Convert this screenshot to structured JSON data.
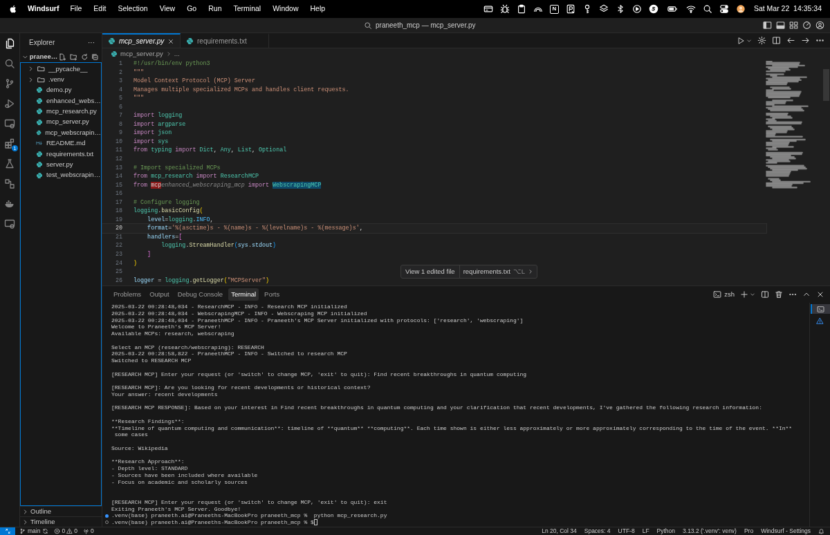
{
  "menu_bar": {
    "app": "Windsurf",
    "menus": [
      "File",
      "Edit",
      "Selection",
      "View",
      "Go",
      "Run",
      "Terminal",
      "Window",
      "Help"
    ],
    "status_icons": [
      {
        "kind": "card"
      },
      {
        "kind": "bug"
      },
      {
        "kind": "clipboard"
      },
      {
        "kind": "gauge"
      },
      {
        "kind": "letter",
        "label": "N"
      },
      {
        "kind": "document"
      },
      {
        "kind": "key"
      },
      {
        "kind": "layers"
      },
      {
        "kind": "bluetooth"
      },
      {
        "kind": "play"
      },
      {
        "kind": "disc"
      },
      {
        "kind": "battery"
      },
      {
        "kind": "wifi"
      },
      {
        "kind": "search"
      },
      {
        "kind": "toggles"
      },
      {
        "kind": "avatar"
      }
    ],
    "clock": "Sat Mar 22  14:35:34"
  },
  "title_bar": {
    "search": "praneeth_mcp — mcp_server.py"
  },
  "activity_bar": [
    {
      "kind": "files",
      "selected": true
    },
    {
      "kind": "search",
      "selected": false
    },
    {
      "kind": "branch",
      "selected": false
    },
    {
      "kind": "run",
      "selected": false
    },
    {
      "kind": "monitor",
      "selected": false
    },
    {
      "kind": "blocks",
      "selected": false,
      "badge": "1"
    },
    {
      "kind": "flask",
      "selected": false
    },
    {
      "kind": "nodes",
      "selected": false
    },
    {
      "kind": "whale",
      "selected": false
    },
    {
      "kind": "monitor",
      "selected": false
    }
  ],
  "sidebar": {
    "title": "Explorer",
    "more": "···",
    "root": {
      "label": "pranee…",
      "expanded": true
    },
    "items": [
      {
        "label": "__pycache__",
        "kind": "folder"
      },
      {
        "label": ".venv",
        "kind": "folder"
      },
      {
        "label": "demo.py",
        "kind": "python"
      },
      {
        "label": "enhanced_webs…",
        "kind": "python"
      },
      {
        "label": "mcp_research.py",
        "kind": "python"
      },
      {
        "label": "mcp_server.py",
        "kind": "python"
      },
      {
        "label": "mcp_webscrapin…",
        "kind": "python"
      },
      {
        "label": "README.md",
        "kind": "markdown"
      },
      {
        "label": "requirements.txt",
        "kind": "python"
      },
      {
        "label": "server.py",
        "kind": "python"
      },
      {
        "label": "test_webscrapin…",
        "kind": "python"
      }
    ],
    "sections": [
      "Outline",
      "Timeline"
    ]
  },
  "editor": {
    "tabs": [
      {
        "label": "mcp_server.py",
        "selected": true
      },
      {
        "label": "requirements.txt",
        "selected": false
      }
    ],
    "breadcrumb": [
      "mcp_server.py",
      "..."
    ],
    "lines": [
      {
        "number": "1",
        "current": false,
        "segments": [
          {
            "text": "#!/usr/bin/env python3",
            "kind": "comment"
          }
        ]
      },
      {
        "number": "2",
        "current": false,
        "segments": [
          {
            "text": "\"\"\"",
            "kind": "string"
          }
        ]
      },
      {
        "number": "3",
        "current": false,
        "segments": [
          {
            "text": "Model Context Protocol (MCP) Server",
            "kind": "string"
          }
        ]
      },
      {
        "number": "4",
        "current": false,
        "segments": [
          {
            "text": "Manages multiple specialized MCPs and handles client requests.",
            "kind": "string"
          }
        ]
      },
      {
        "number": "5",
        "current": false,
        "segments": [
          {
            "text": "\"\"\"",
            "kind": "string"
          }
        ]
      },
      {
        "number": "6",
        "current": false
      },
      {
        "number": "7",
        "current": false,
        "segments": [
          {
            "text": "import ",
            "kind": "keyword"
          },
          {
            "text": "logging",
            "kind": "type"
          }
        ]
      },
      {
        "number": "8",
        "current": false,
        "segments": [
          {
            "text": "import ",
            "kind": "keyword"
          },
          {
            "text": "argparse",
            "kind": "type"
          }
        ]
      },
      {
        "number": "9",
        "current": false,
        "segments": [
          {
            "text": "import ",
            "kind": "keyword"
          },
          {
            "text": "json",
            "kind": "type"
          }
        ]
      },
      {
        "number": "10",
        "current": false,
        "segments": [
          {
            "text": "import ",
            "kind": "keyword"
          },
          {
            "text": "sys",
            "kind": "type"
          }
        ]
      },
      {
        "number": "11",
        "current": false,
        "segments": [
          {
            "text": "from ",
            "kind": "keyword"
          },
          {
            "text": "typing ",
            "kind": "type"
          },
          {
            "text": "import ",
            "kind": "keyword"
          },
          {
            "text": "Dict",
            "kind": "type"
          },
          {
            "text": ", ",
            "kind": "plain"
          },
          {
            "text": "Any",
            "kind": "type"
          },
          {
            "text": ", ",
            "kind": "plain"
          },
          {
            "text": "List",
            "kind": "type"
          },
          {
            "text": ", ",
            "kind": "plain"
          },
          {
            "text": "Optional",
            "kind": "type"
          }
        ]
      },
      {
        "number": "12",
        "current": false
      },
      {
        "number": "13",
        "current": false,
        "segments": [
          {
            "text": "# Import specialized MCPs",
            "kind": "comment"
          }
        ]
      },
      {
        "number": "14",
        "current": false,
        "segments": [
          {
            "text": "from ",
            "kind": "keyword"
          },
          {
            "text": "mcp_research ",
            "kind": "type"
          },
          {
            "text": "import ",
            "kind": "keyword"
          },
          {
            "text": "ResearchMCP",
            "kind": "type"
          }
        ]
      },
      {
        "number": "15",
        "current": false,
        "segments": [
          {
            "text": "from ",
            "kind": "keyword"
          },
          {
            "text": "mcp",
            "kind": "removed"
          },
          {
            "text": "enhanced_webscraping_mcp",
            "kind": "suggestion"
          },
          {
            "text": " import ",
            "kind": "keyword"
          },
          {
            "text": "WebscrapingMCP",
            "kind": "highlight"
          }
        ]
      },
      {
        "number": "16",
        "current": false
      },
      {
        "number": "17",
        "current": false,
        "segments": [
          {
            "text": "# Configure logging",
            "kind": "comment"
          }
        ]
      },
      {
        "number": "18",
        "current": false,
        "segments": [
          {
            "text": "logging",
            "kind": "type"
          },
          {
            "text": ".",
            "kind": "plain"
          },
          {
            "text": "basicConfig",
            "kind": "function"
          },
          {
            "text": "(",
            "kind": "bracket"
          }
        ]
      },
      {
        "number": "19",
        "current": false,
        "segments": [
          {
            "text": "    level",
            "kind": "variable"
          },
          {
            "text": "=",
            "kind": "plain"
          },
          {
            "text": "logging",
            "kind": "type"
          },
          {
            "text": ".",
            "kind": "plain"
          },
          {
            "text": "INFO",
            "kind": "constant"
          },
          {
            "text": ",",
            "kind": "plain"
          }
        ]
      },
      {
        "number": "20",
        "current": true,
        "segments": [
          {
            "text": "    format",
            "kind": "variable"
          },
          {
            "text": "=",
            "kind": "plain"
          },
          {
            "text": "'%(asctime)s - %(name)s - %(levelname)s - %(message)s'",
            "kind": "string"
          },
          {
            "text": ",",
            "kind": "plain"
          }
        ]
      },
      {
        "number": "21",
        "current": false,
        "segments": [
          {
            "text": "    handlers",
            "kind": "variable"
          },
          {
            "text": "=",
            "kind": "plain"
          },
          {
            "text": "[",
            "kind": "bracket2"
          }
        ]
      },
      {
        "number": "22",
        "current": false,
        "segments": [
          {
            "text": "        logging",
            "kind": "type"
          },
          {
            "text": ".",
            "kind": "plain"
          },
          {
            "text": "StreamHandler",
            "kind": "function"
          },
          {
            "text": "(",
            "kind": "bracket3"
          },
          {
            "text": "sys",
            "kind": "variable"
          },
          {
            "text": ".",
            "kind": "plain"
          },
          {
            "text": "stdout",
            "kind": "variable"
          },
          {
            "text": ")",
            "kind": "bracket3"
          }
        ]
      },
      {
        "number": "23",
        "current": false,
        "segments": [
          {
            "text": "    ]",
            "kind": "bracket2"
          }
        ]
      },
      {
        "number": "24",
        "current": false,
        "segments": [
          {
            "text": ")",
            "kind": "bracket"
          }
        ]
      },
      {
        "number": "25",
        "current": false
      },
      {
        "number": "26",
        "current": false,
        "segments": [
          {
            "text": "logger",
            "kind": "variable"
          },
          {
            "text": " = ",
            "kind": "plain"
          },
          {
            "text": "logging",
            "kind": "type"
          },
          {
            "text": ".",
            "kind": "plain"
          },
          {
            "text": "getLogger",
            "kind": "function"
          },
          {
            "text": "(",
            "kind": "bracket"
          },
          {
            "text": "\"MCPServer\"",
            "kind": "string"
          },
          {
            "text": ")",
            "kind": "bracket"
          }
        ]
      }
    ],
    "edit_notice": {
      "action": "View 1 edited file",
      "file": "requirements.txt",
      "shortcut": "⌥L"
    }
  },
  "panel": {
    "tabs": [
      {
        "label": "Problems",
        "selected": false
      },
      {
        "label": "Output",
        "selected": false
      },
      {
        "label": "Debug Console",
        "selected": false
      },
      {
        "label": "Terminal",
        "selected": true
      },
      {
        "label": "Ports",
        "selected": false
      }
    ],
    "shell": "zsh",
    "terminal_blocks": [
      {
        "lines": [
          "2025-03-22 00:28:48,034 - ResearchMCP - INFO - Research MCP initialized",
          "2025-03-22 00:28:48,034 - WebscrapingMCP - INFO - Webscraping MCP initialized",
          "2025-03-22 00:28:48,034 - PraneethMCP - INFO - Praneeth's MCP Server initialized with protocols: ['research', 'webscraping']",
          "Welcome to Praneeth's MCP Server!",
          "Available MCPs: research, webscraping"
        ]
      },
      {
        "lines": [
          "Select an MCP (research/webscraping): RESEARCH",
          "2025-03-22 00:28:58,822 - PraneethMCP - INFO - Switched to research MCP",
          "Switched to RESEARCH MCP"
        ]
      },
      {
        "lines": [
          "[RESEARCH MCP] Enter your request (or 'switch' to change MCP, 'exit' to quit): Find recent breakthroughs in quantum computing"
        ]
      },
      {
        "lines": [
          "[RESEARCH MCP]: Are you looking for recent developments or historical context?",
          "Your answer: recent developments"
        ]
      },
      {
        "lines": [
          "[RESEARCH MCP RESPONSE]: Based on your interest in Find recent breakthroughs in quantum computing and your clarification that recent developments, I've gathered the following research information:"
        ]
      },
      {
        "lines": [
          "**Research Findings**:",
          "**Timeline of quantum computing and communication**: timeline of **quantum** **computing**. Each time shown is either less approximately or more approximately corresponding to the time of the event. **In**",
          " some cases"
        ]
      },
      {
        "lines": [
          "Source: Wikipedia"
        ]
      },
      {
        "lines": [
          "**Research Approach**:",
          "- Depth level: STANDARD",
          "- Sources have been included where available",
          "- Focus on academic and scholarly sources"
        ]
      }
    ],
    "closing_lines": [
      "[RESEARCH MCP] Enter your request (or 'switch' to change MCP, 'exit' to quit): exit",
      "Exiting Praneeth's MCP Server. Goodbye!"
    ],
    "commands": [
      {
        "text": ".venv(base) praneeth.ai@Praneeths-MacBookPro praneeth_mcp %  python mcp_research.py",
        "finished": true,
        "cursor": false
      },
      {
        "text": ".venv(base) praneeth.ai@Praneeths-MacBookPro praneeth_mcp % $",
        "finished": false,
        "cursor": true
      }
    ]
  },
  "status_bar": {
    "branch": "main",
    "errors": "0",
    "warnings": "0",
    "ports": "0",
    "right": [
      "Ln 20, Col 34",
      "Spaces: 4",
      "UTF-8",
      "LF",
      "Python",
      "3.13.2 ('.venv': venv)",
      "Pro",
      "Windsurf - Settings"
    ]
  }
}
